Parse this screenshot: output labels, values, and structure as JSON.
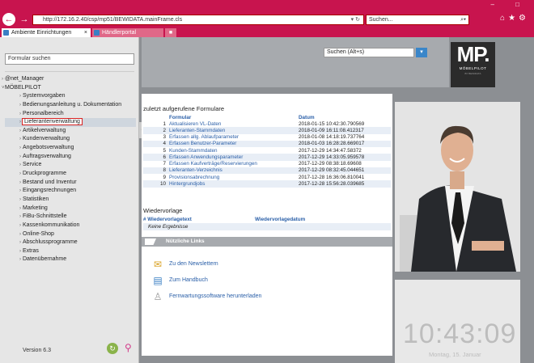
{
  "browser": {
    "url": "http://172.16.2.40/csp/mp51/BEWIDATA.mainFrame.cls",
    "search_placeholder": "Suchen...",
    "tabs": [
      {
        "label": "Ambiente Einrichtungen"
      },
      {
        "label": "Händlerportal"
      }
    ],
    "accent": "#c8144e"
  },
  "sidebar": {
    "search_value": "Formular suchen",
    "groups": [
      {
        "label": "@net_Manager"
      },
      {
        "label": "MÖBELPILOT"
      }
    ],
    "items": [
      {
        "label": "Systemvorgaben"
      },
      {
        "label": "Bedienungsanleitung u. Dokumentation"
      },
      {
        "label": "Personalbereich"
      },
      {
        "label": "Lieferantenverwaltung",
        "selected": true
      },
      {
        "label": "Artikelverwaltung"
      },
      {
        "label": "Kundenverwaltung"
      },
      {
        "label": "Angebotsverwaltung"
      },
      {
        "label": "Auftragsverwaltung"
      },
      {
        "label": "Service"
      },
      {
        "label": "Druckprogramme"
      },
      {
        "label": "Bestand und Inventur"
      },
      {
        "label": "Eingangsrechnungen"
      },
      {
        "label": "Statistiken"
      },
      {
        "label": "Marketing"
      },
      {
        "label": "FiBu-Schnittstelle"
      },
      {
        "label": "Kassenkommunikation"
      },
      {
        "label": "Online-Shop"
      },
      {
        "label": "Abschlussprogramme"
      },
      {
        "label": "Extras"
      },
      {
        "label": "Datenübernahme"
      }
    ],
    "version": "Version 6.3"
  },
  "header": {
    "search_placeholder": "Suchen (Alt+s)"
  },
  "logo": {
    "mark": "MP.",
    "name": "MÖBELPILOT",
    "tagline": "BY BEWIDATA"
  },
  "recent": {
    "title": "zuletzt aufgerufene Formulare",
    "col_form": "Formular",
    "col_date": "Datum",
    "rows": [
      {
        "n": "1",
        "name": "Aktualisieren VL-Daten",
        "date": "2018-01-15 10:42:30.790569"
      },
      {
        "n": "2",
        "name": "Lieferanten-Stammdaten",
        "date": "2018-01-09 16:11:08.412317"
      },
      {
        "n": "3",
        "name": "Erfassen allg. Ablaufparameter",
        "date": "2018-01-08 14:18:19.737764"
      },
      {
        "n": "4",
        "name": "Erfassen Benutzer-Parameter",
        "date": "2018-01-03 16:28:28.669017"
      },
      {
        "n": "5",
        "name": "Kunden-Stammdaten",
        "date": "2017-12-29 14:34:47.58372"
      },
      {
        "n": "6",
        "name": "Erfassen Anwendungsparameter",
        "date": "2017-12-29 14:33:05.959578"
      },
      {
        "n": "7",
        "name": "Erfassen Kaufverträge/Reservierungen",
        "date": "2017-12-29 08:38:18.69608"
      },
      {
        "n": "8",
        "name": "Lieferanten-Verzeichnis",
        "date": "2017-12-29 08:32:45.044651"
      },
      {
        "n": "9",
        "name": "Provisionsabrechnung",
        "date": "2017-12-28 16:36:06.810041"
      },
      {
        "n": "10",
        "name": "Hintergrundjobs",
        "date": "2017-12-28 15:56:28.039685"
      }
    ]
  },
  "wiedervorlage": {
    "title": "Wiedervorlage",
    "col_hash": "#",
    "col_text": "Wiedervorlagetext",
    "col_date": "Wiedervorlagedatum",
    "empty": "Keine Ergebnisse"
  },
  "links": {
    "title": "Nützliche Links",
    "items": [
      {
        "label": "Zu den Newslettern",
        "icon": "newsletter-icon"
      },
      {
        "label": "Zum Handbuch",
        "icon": "book-icon"
      },
      {
        "label": "Fernwartungssoftware herunterladen",
        "icon": "person-icon"
      }
    ]
  },
  "clock": {
    "time": "10:43:09",
    "date": "Montag, 15. Januar"
  }
}
